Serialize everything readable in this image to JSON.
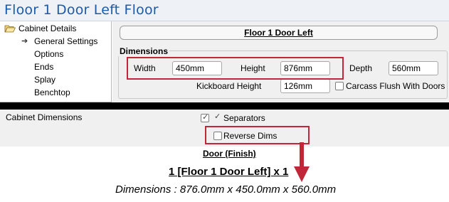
{
  "window": {
    "title": "Floor 1 Door Left Floor"
  },
  "tree": {
    "root": "Cabinet Details",
    "items": [
      {
        "label": "General Settings",
        "selected": true
      },
      {
        "label": "Options"
      },
      {
        "label": "Ends"
      },
      {
        "label": "Splay"
      },
      {
        "label": "Benchtop"
      }
    ]
  },
  "cabinet": {
    "title_button": "Floor 1 Door Left"
  },
  "dimensions": {
    "legend": "Dimensions",
    "width_label": "Width",
    "width_value": "450mm",
    "height_label": "Height",
    "height_value": "876mm",
    "depth_label": "Depth",
    "depth_value": "560mm",
    "kickboard_label": "Kickboard Height",
    "kickboard_value": "126mm",
    "carcass_flush_label": "Carcass Flush With Doors",
    "carcass_flush_checked": false
  },
  "cabinet_dimensions": {
    "label": "Cabinet Dimensions",
    "separators_label": "Separators",
    "separators_checked": true,
    "reverse_dims_label": "Reverse Dims",
    "reverse_dims_checked": false
  },
  "report": {
    "heading": "Door (Finish)",
    "cabinet_line": "1  [Floor 1 Door Left] x 1",
    "dimensions_line": "Dimensions : 876.0mm x 450.0mm x 560.0mm"
  },
  "colors": {
    "title_text": "#1e5aa8",
    "highlight": "#c0283a",
    "panel_bg": "#f0f0f0"
  },
  "icons": {
    "tree_root": "folder-open-icon",
    "selected_item": "arrow-right-icon",
    "annotation": "red-arrow-down-icon"
  }
}
